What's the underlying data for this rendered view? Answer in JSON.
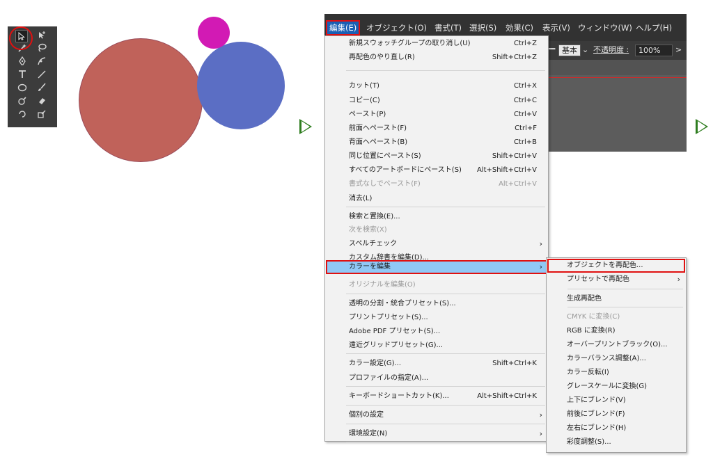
{
  "menubar": {
    "items": [
      "編集(E)",
      "オブジェクト(O)",
      "書式(T)",
      "選択(S)",
      "効果(C)",
      "表示(V)",
      "ウィンドウ(W)",
      "ヘルプ(H)"
    ]
  },
  "controlbar": {
    "stroke_style": "基本",
    "opacity_label": "不透明度 :",
    "opacity_value": "100%",
    "more": ">"
  },
  "edit_menu": {
    "items": [
      {
        "label": "新規スウォッチグループの取り消し(U)",
        "shortcut": "Ctrl+Z"
      },
      {
        "label": "再配色のやり直し(R)",
        "shortcut": "Shift+Ctrl+Z"
      },
      {
        "label": "カット(T)",
        "shortcut": "Ctrl+X"
      },
      {
        "label": "コピー(C)",
        "shortcut": "Ctrl+C"
      },
      {
        "label": "ペースト(P)",
        "shortcut": "Ctrl+V"
      },
      {
        "label": "前面へペースト(F)",
        "shortcut": "Ctrl+F"
      },
      {
        "label": "背面へペースト(B)",
        "shortcut": "Ctrl+B"
      },
      {
        "label": "同じ位置にペースト(S)",
        "shortcut": "Shift+Ctrl+V"
      },
      {
        "label": "すべてのアートボードにペースト(S)",
        "shortcut": "Alt+Shift+Ctrl+V"
      },
      {
        "label": "書式なしでペースト(F)",
        "shortcut": "Alt+Ctrl+V",
        "disabled": true
      },
      {
        "label": "消去(L)",
        "shortcut": ""
      },
      {
        "label": "検索と置換(E)...",
        "shortcut": ""
      },
      {
        "label": "次を検索(X)",
        "shortcut": "",
        "disabled": true
      },
      {
        "label": "スペルチェック",
        "shortcut": "",
        "submenu": true
      },
      {
        "label": "カスタム辞書を編集(D)...",
        "shortcut": ""
      },
      {
        "label": "カラーを編集",
        "shortcut": "",
        "submenu": true,
        "highlighted": true
      },
      {
        "label": "オリジナルを編集(O)",
        "shortcut": "",
        "disabled": true
      },
      {
        "label": "透明の分割・統合プリセット(S)...",
        "shortcut": ""
      },
      {
        "label": "プリントプリセット(S)...",
        "shortcut": ""
      },
      {
        "label": "Adobe PDF プリセット(S)...",
        "shortcut": ""
      },
      {
        "label": "遠近グリッドプリセット(G)...",
        "shortcut": ""
      },
      {
        "label": "カラー設定(G)...",
        "shortcut": "Shift+Ctrl+K"
      },
      {
        "label": "プロファイルの指定(A)...",
        "shortcut": ""
      },
      {
        "label": "キーボードショートカット(K)...",
        "shortcut": "Alt+Shift+Ctrl+K"
      },
      {
        "label": "個別の設定",
        "shortcut": "",
        "submenu": true
      },
      {
        "label": "環境設定(N)",
        "shortcut": "",
        "submenu": true
      }
    ]
  },
  "color_submenu": {
    "items": [
      {
        "label": "オブジェクトを再配色..."
      },
      {
        "label": "プリセットで再配色",
        "submenu": true
      },
      {
        "label": "生成再配色"
      },
      {
        "label": "CMYK に変換(C)",
        "disabled": true
      },
      {
        "label": "RGB に変換(R)"
      },
      {
        "label": "オーバープリントブラック(O)..."
      },
      {
        "label": "カラーバランス調整(A)..."
      },
      {
        "label": "カラー反転(I)"
      },
      {
        "label": "グレースケールに変換(G)"
      },
      {
        "label": "上下にブレンド(V)"
      },
      {
        "label": "前後にブレンド(F)"
      },
      {
        "label": "左右にブレンド(H)"
      },
      {
        "label": "彩度調整(S)..."
      }
    ]
  },
  "submenu_arrow": "›",
  "colors": {
    "circle_red": "#c0625a",
    "circle_blue": "#5b6ec4",
    "circle_magenta": "#d21ab4",
    "highlight": "#90c8f6",
    "annotation": "#e01010",
    "arrow": "#2e7d1f"
  }
}
